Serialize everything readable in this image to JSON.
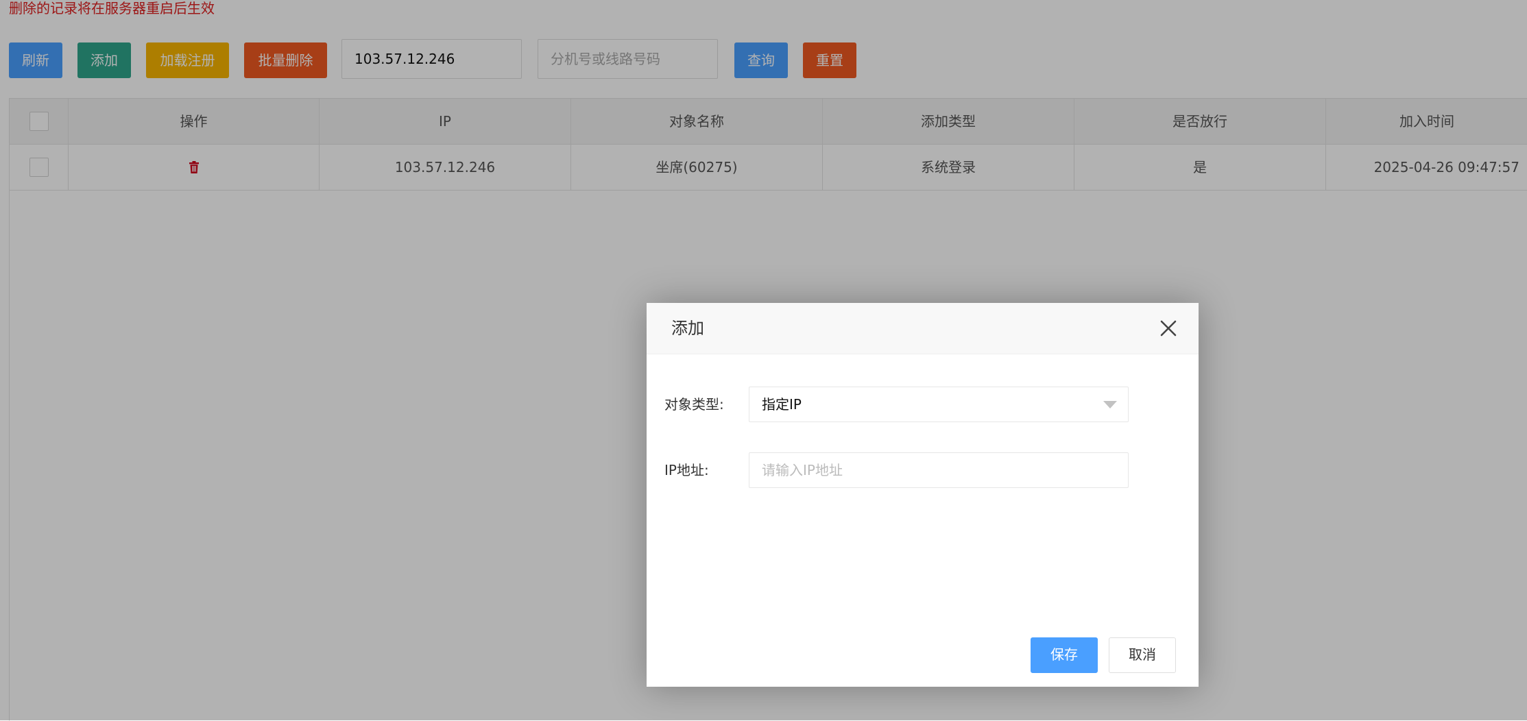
{
  "notice": "删除的记录将在服务器重启后生效",
  "toolbar": {
    "refresh": "刷新",
    "add": "添加",
    "load_register": "加载注册",
    "batch_delete": "批量删除",
    "ip_search_value": "103.57.12.246",
    "ext_search_placeholder": "分机号或线路号码",
    "query": "查询",
    "reset": "重置"
  },
  "table": {
    "columns": [
      "",
      "操作",
      "IP",
      "对象名称",
      "添加类型",
      "是否放行",
      "加入时间"
    ],
    "rows": [
      {
        "ip": "103.57.12.246",
        "name": "坐席(60275)",
        "add_type": "系统登录",
        "allowed": "是",
        "added_at": "2025-04-26 09:47:57",
        "action_icon": "trash-icon"
      }
    ]
  },
  "dialog": {
    "title": "添加",
    "object_type_label": "对象类型:",
    "object_type_value": "指定IP",
    "ip_label": "IP地址:",
    "ip_placeholder": "请输入IP地址",
    "save": "保存",
    "cancel": "取消"
  },
  "colors": {
    "blue": "#4a9fff",
    "green": "#2ea58c",
    "yellow": "#f8b500",
    "orange": "#f05a22",
    "notice_red": "#e02020",
    "trash_red": "#d0021b"
  }
}
